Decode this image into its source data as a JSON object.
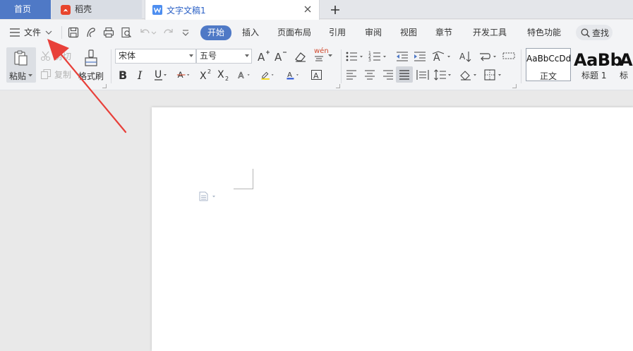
{
  "tabs": {
    "home_label": "首页",
    "daoke_label": "稻壳",
    "doc_label": "文字文稿1",
    "add_symbol": "+"
  },
  "menu": {
    "file_label": "文件",
    "items": [
      "开始",
      "插入",
      "页面布局",
      "引用",
      "审阅",
      "视图",
      "章节",
      "开发工具",
      "特色功能"
    ],
    "search_label": "查找"
  },
  "clipboard": {
    "paste_label": "粘贴",
    "cut_label": "剪切",
    "copy_label": "复制",
    "format_painter_label": "格式刷"
  },
  "font": {
    "name": "宋体",
    "size": "五号",
    "phonetic_label": "wén"
  },
  "styles": [
    {
      "preview": "AaBbCcDd",
      "label": "正文"
    },
    {
      "preview": "AaBb",
      "label": "标题 1"
    },
    {
      "preview": "Aa",
      "label": "标"
    }
  ],
  "colors": {
    "accent": "#4f79c6",
    "font_color_bar": "#2b56d6",
    "highlight_bar": "#f5d90a",
    "annotation_arrow": "#e8403a",
    "doc_tab_text": "#2b61c6"
  },
  "icons": {
    "file_menu": "hamburger-icon",
    "daoke": "daoke-logo-icon",
    "doc_tab": "wps-writer-icon"
  }
}
